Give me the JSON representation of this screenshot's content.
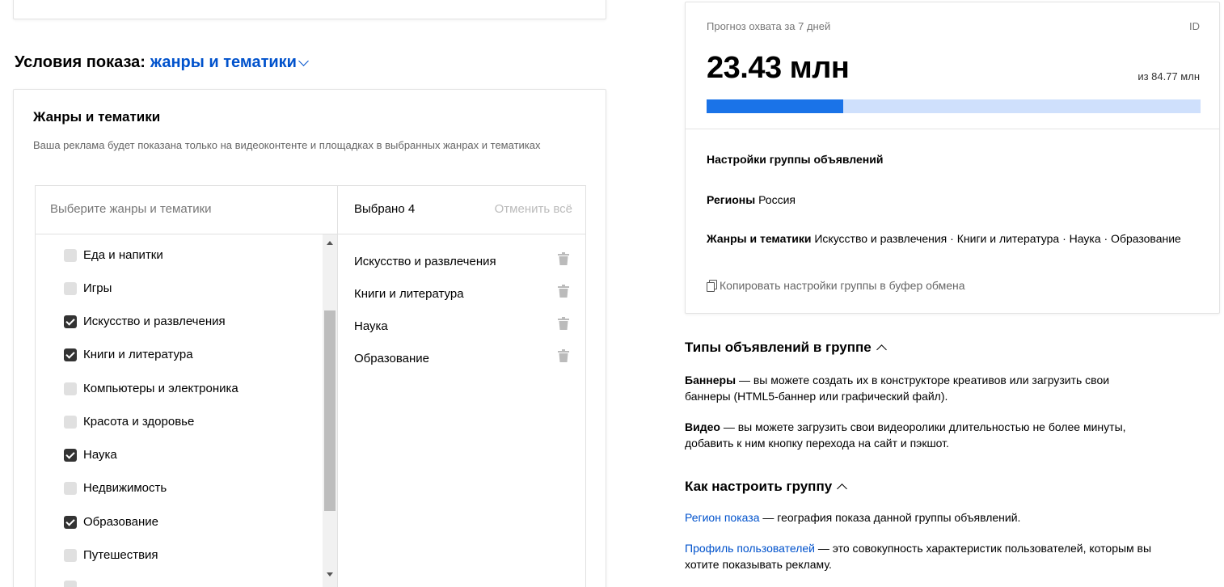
{
  "conditions": {
    "prefix": "Условия показа:",
    "link": "жанры и тематики"
  },
  "genres": {
    "heading": "Жанры и тематики",
    "description": "Ваша реклама будет показана только на видеоконтенте и площадках в выбранных жанрах и тематиках",
    "search_placeholder": "Выберите жанры и тематики",
    "selected_count": "Выбрано 4",
    "clear_all": "Отменить всё",
    "items": [
      {
        "label": "Еда и напитки",
        "checked": false
      },
      {
        "label": "Игры",
        "checked": false
      },
      {
        "label": "Искусство и развлечения",
        "checked": true
      },
      {
        "label": "Книги и литература",
        "checked": true
      },
      {
        "label": "Компьютеры и электроника",
        "checked": false
      },
      {
        "label": "Красота и здоровье",
        "checked": false
      },
      {
        "label": "Наука",
        "checked": true
      },
      {
        "label": "Недвижимость",
        "checked": false
      },
      {
        "label": "Образование",
        "checked": true
      },
      {
        "label": "Путешествия",
        "checked": false
      }
    ],
    "selected": [
      "Искусство и развлечения",
      "Книги и литература",
      "Наука",
      "Образование"
    ]
  },
  "reach": {
    "label": "Прогноз охвата за 7 дней",
    "id_label": "ID",
    "value": "23.43 млн",
    "total": "из 84.77 млн",
    "progress_fraction": 0.2764
  },
  "group_settings": {
    "heading": "Настройки группы объявлений",
    "regions_label": "Регионы",
    "regions_value": "Россия",
    "genres_label": "Жанры и тематики",
    "genres_value": "Искусство и развлечения · Книги и литература · Наука · Образование",
    "copy_link": "Копировать настройки группы в буфер обмена"
  },
  "ad_types": {
    "heading": "Типы объявлений в группе",
    "banners_bold": "Баннеры",
    "banners_text": " — вы можете создать их в конструкторе креативов или загрузить свои баннеры (HTML5-баннер или графический файл).",
    "video_bold": "Видео",
    "video_text": " — вы можете загрузить свои видеоролики длительностью не более минуты, добавить к ним кнопку перехода на сайт и пэкшот."
  },
  "howto": {
    "heading": "Как настроить группу",
    "region_link": "Регион показа",
    "region_text": " — география показа данной группы объявлений.",
    "profile_link": "Профиль пользователей",
    "profile_text": " — это совокупность характеристик пользователей, которым вы хотите показывать рекламу."
  },
  "colors": {
    "link": "#0052cc",
    "progress_fill": "#1a73e8",
    "progress_track": "#cfe0fc",
    "checkbox_on": "#333333"
  }
}
